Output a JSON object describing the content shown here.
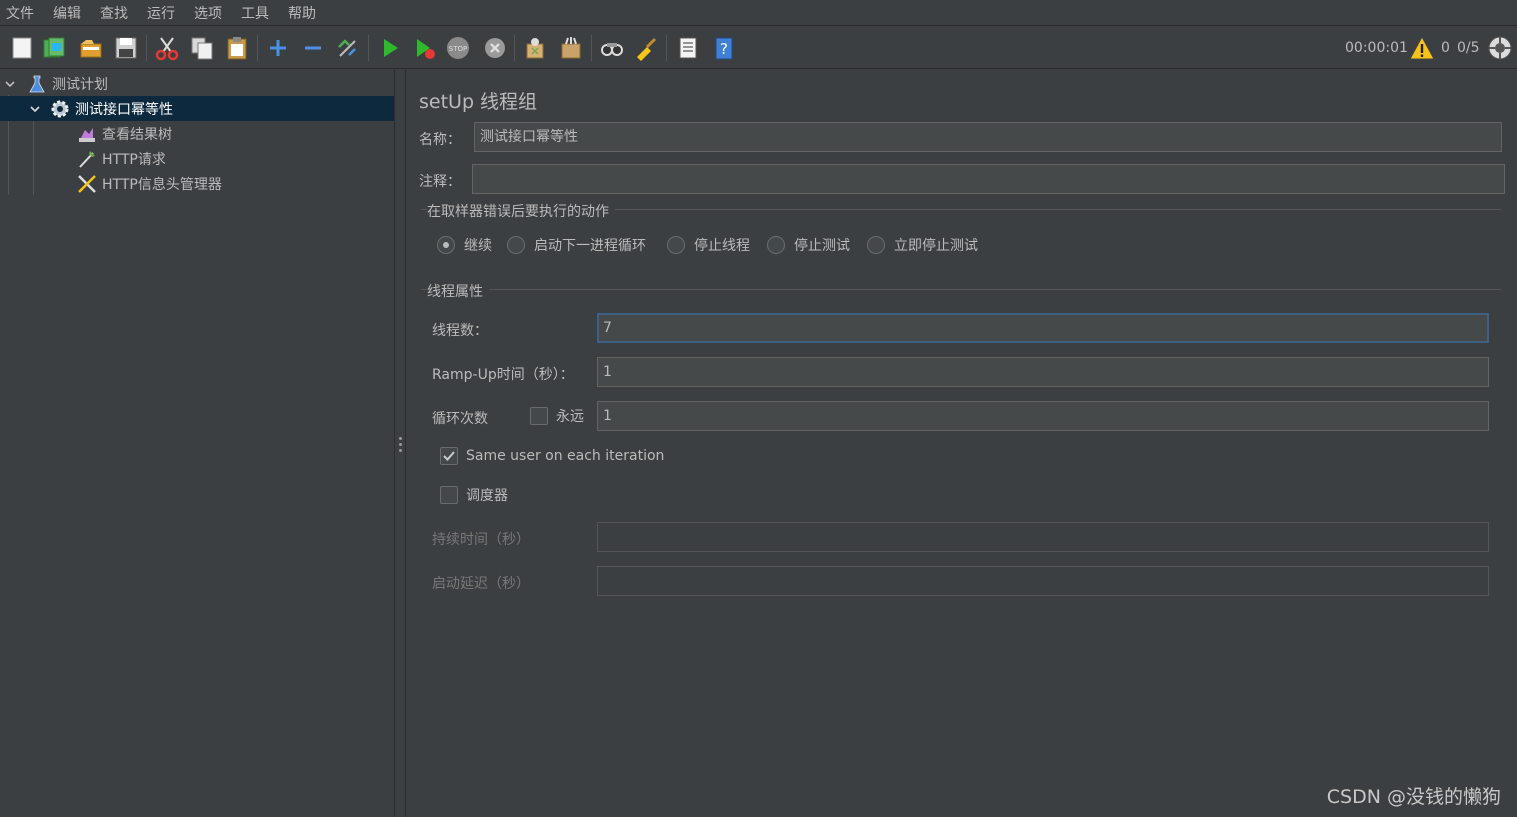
{
  "menu": [
    "文件",
    "编辑",
    "查找",
    "运行",
    "选项",
    "工具",
    "帮助"
  ],
  "toolbar": {
    "icons": [
      "new-icon",
      "templates-icon",
      "open-icon",
      "save-icon",
      "cut-icon",
      "copy-icon",
      "paste-icon",
      "expand-icon",
      "collapse-icon",
      "toggle-icon",
      "start-icon",
      "start-no-pause-icon",
      "stop-icon",
      "shutdown-icon",
      "clear-icon",
      "clear-all-icon",
      "search-icon",
      "reset-search-icon",
      "function-helper-icon",
      "help-icon"
    ]
  },
  "status": {
    "elapsed": "00:00:01",
    "warnings": "0",
    "threads": "0/5"
  },
  "tree": {
    "items": [
      {
        "label": "测试计划",
        "icon": "test-plan-icon",
        "level": 0,
        "expanded": true
      },
      {
        "label": "测试接口幂等性",
        "icon": "setup-thread-group-icon",
        "level": 1,
        "expanded": true,
        "selected": true
      },
      {
        "label": "查看结果树",
        "icon": "view-results-tree-icon",
        "level": 2
      },
      {
        "label": "HTTP请求",
        "icon": "http-request-icon",
        "level": 2
      },
      {
        "label": "HTTP信息头管理器",
        "icon": "header-manager-icon",
        "level": 2
      }
    ]
  },
  "panel": {
    "title": "setUp 线程组",
    "name_label": "名称：",
    "name_value": "测试接口幂等性",
    "comment_label": "注释：",
    "comment_value": "",
    "error_action": {
      "title": "在取样器错误后要执行的动作",
      "options": [
        "继续",
        "启动下一进程循环",
        "停止线程",
        "停止测试",
        "立即停止测试"
      ],
      "selected": "继续"
    },
    "thread_props": {
      "title": "线程属性",
      "threads_label": "线程数：",
      "threads_value": "7",
      "rampup_label": "Ramp-Up时间（秒）：",
      "rampup_value": "1",
      "loop_label": "循环次数",
      "forever_label": "永远",
      "forever_checked": false,
      "loop_value": "1",
      "same_user_label": "Same user on each iteration",
      "same_user_checked": true,
      "scheduler_label": "调度器",
      "scheduler_checked": false,
      "duration_label": "持续时间（秒）",
      "duration_value": "",
      "delay_label": "启动延迟（秒）",
      "delay_value": ""
    }
  },
  "watermark": "CSDN @没钱的懒狗"
}
